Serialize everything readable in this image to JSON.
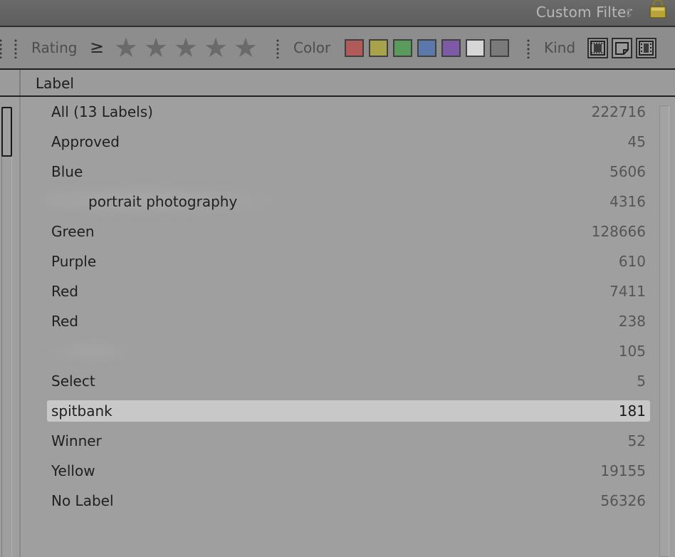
{
  "topbar": {
    "preset_label": "Custom Filter",
    "preset_arrows": "▲▼"
  },
  "filterbar": {
    "rating_label": "Rating",
    "rating_operator": "≥",
    "stars": [
      "★",
      "★",
      "★",
      "★",
      "★"
    ],
    "color_label": "Color",
    "color_swatches": [
      "#b05a5a",
      "#a8a24a",
      "#5a9a5a",
      "#5a78aa",
      "#7e5aa6",
      "#d6d6d6",
      "#7a7a7a"
    ],
    "kind_label": "Kind"
  },
  "header": {
    "title": "Label"
  },
  "labels": [
    {
      "name": "All (13 Labels)",
      "count": "222716"
    },
    {
      "name": "Approved",
      "count": "45"
    },
    {
      "name": "Blue",
      "count": "5606"
    },
    {
      "name": "portrait photography",
      "count": "4316"
    },
    {
      "name": "Green",
      "count": "128666"
    },
    {
      "name": "Purple",
      "count": "610"
    },
    {
      "name": "Red",
      "count": "7411"
    },
    {
      "name": "Red",
      "count": "238"
    },
    {
      "name": "",
      "count": "105"
    },
    {
      "name": "Select",
      "count": "5"
    },
    {
      "name": "spitbank",
      "count": "181"
    },
    {
      "name": "Winner",
      "count": "52"
    },
    {
      "name": "Yellow",
      "count": "19155"
    },
    {
      "name": "No Label",
      "count": "56326"
    }
  ]
}
